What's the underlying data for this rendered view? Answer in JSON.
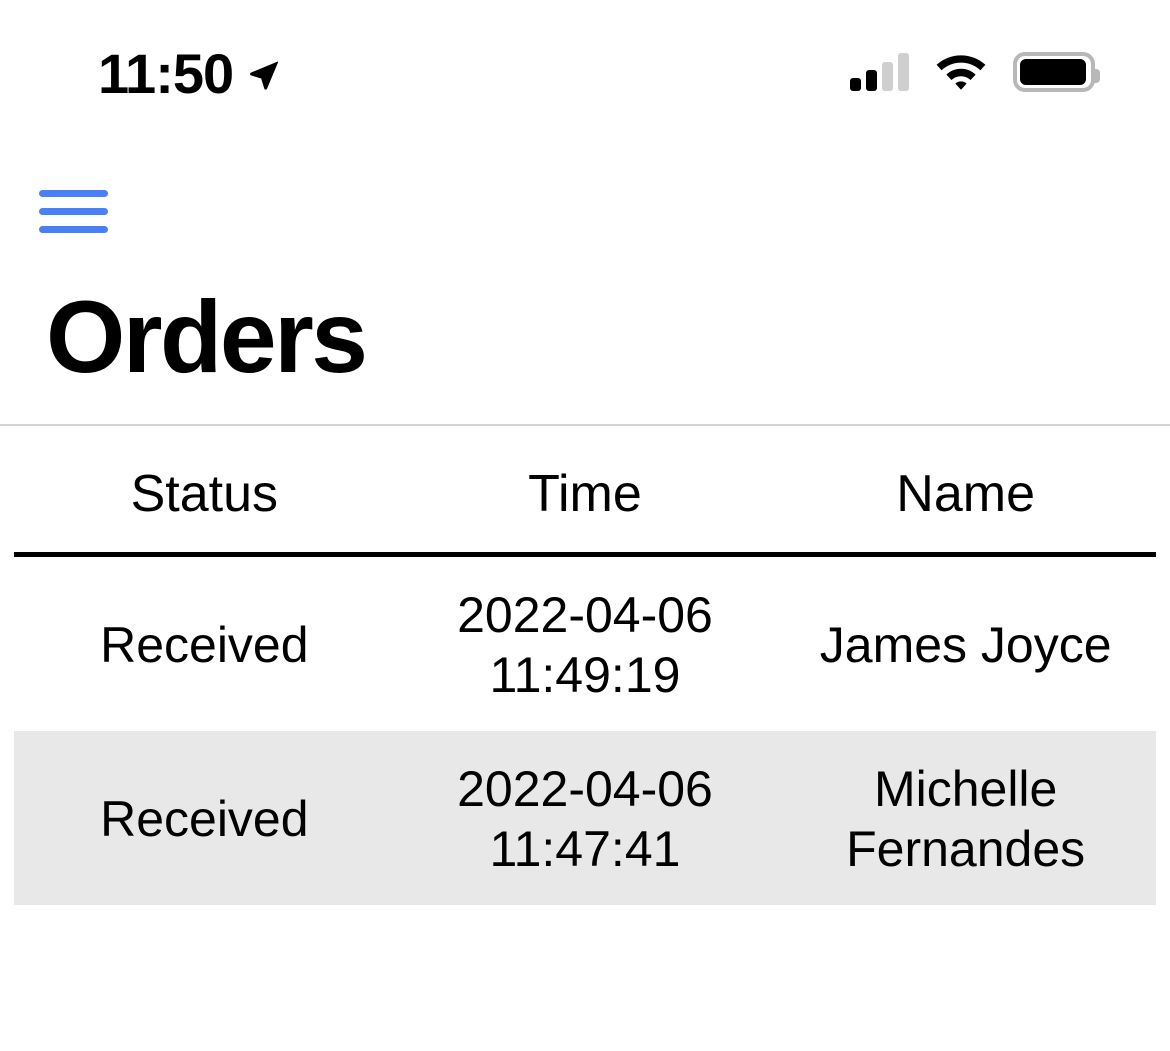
{
  "status_bar": {
    "time": "11:50",
    "location_icon": "location-arrow-icon",
    "cellular_icon": "cellular-signal-icon",
    "cellular_bars_filled": 2,
    "cellular_bars_total": 4,
    "wifi_icon": "wifi-icon",
    "battery_icon": "battery-full-icon"
  },
  "nav": {
    "menu_label": "Menu",
    "menu_icon": "hamburger-menu-icon",
    "menu_color": "#4a80f5"
  },
  "header": {
    "title": "Orders"
  },
  "table": {
    "columns": [
      "Status",
      "Time",
      "Name"
    ],
    "rows": [
      {
        "status": "Received",
        "time": "2022-04-06 11:49:19",
        "name": "James Joyce"
      },
      {
        "status": "Received",
        "time": "2022-04-06 11:47:41",
        "name": "Michelle Fernandes"
      }
    ],
    "stripe_color": "#e8e8e8",
    "header_rule_color": "#000000",
    "divider_color": "#d4d4d4"
  }
}
